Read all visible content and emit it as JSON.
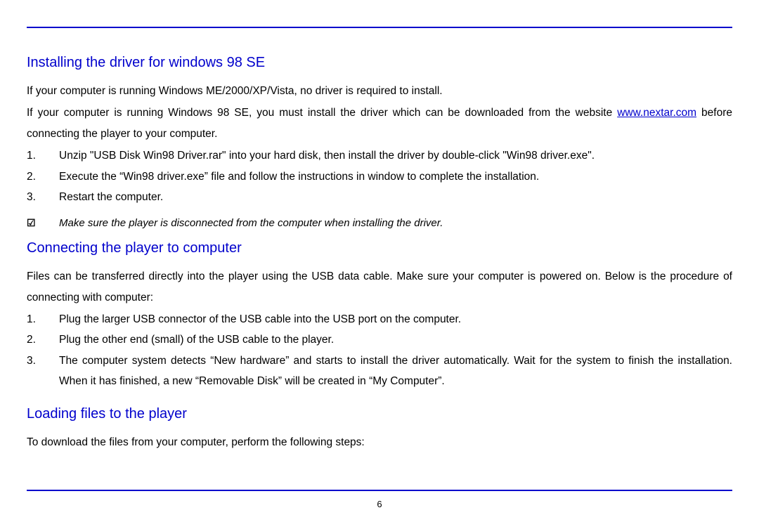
{
  "section1": {
    "heading": "Installing the driver for windows 98 SE",
    "para1": "If your computer is running Windows ME/2000/XP/Vista, no driver is required to install.",
    "para2_pre": "If your computer is running Windows 98 SE, you must install the driver which can be downloaded from the website ",
    "para2_link": "www.nextar.com",
    "para2_post": " before connecting the player to your computer.",
    "steps": [
      {
        "num": "1.",
        "text": "Unzip \"USB Disk Win98 Driver.rar\" into your hard disk, then install the driver by double-click \"Win98 driver.exe\"."
      },
      {
        "num": "2.",
        "text": "Execute the “Win98 driver.exe” file and follow the instructions in window to complete the installation."
      },
      {
        "num": "3.",
        "text": "Restart the computer."
      }
    ],
    "note_icon": "☑",
    "note_text": "Make sure the player is disconnected from the computer when installing the driver."
  },
  "section2": {
    "heading": "Connecting the player to computer",
    "para1": "Files can be transferred directly into the player using the USB data cable. Make sure your computer is powered on. Below is the procedure of connecting with computer:",
    "steps": [
      {
        "num": "1.",
        "text": "Plug the larger USB connector of the USB cable into the USB port on the computer."
      },
      {
        "num": "2.",
        "text": "Plug the other end (small) of the USB cable to the player."
      },
      {
        "num": "3.",
        "text": "The computer system detects “New hardware” and starts to install the driver automatically. Wait for the system to finish the installation. When it has finished, a new “Removable Disk” will be created in “My Computer”."
      }
    ]
  },
  "section3": {
    "heading": "Loading files to the player",
    "para1": "To download the files from your computer, perform the following steps:"
  },
  "page_number": "6"
}
